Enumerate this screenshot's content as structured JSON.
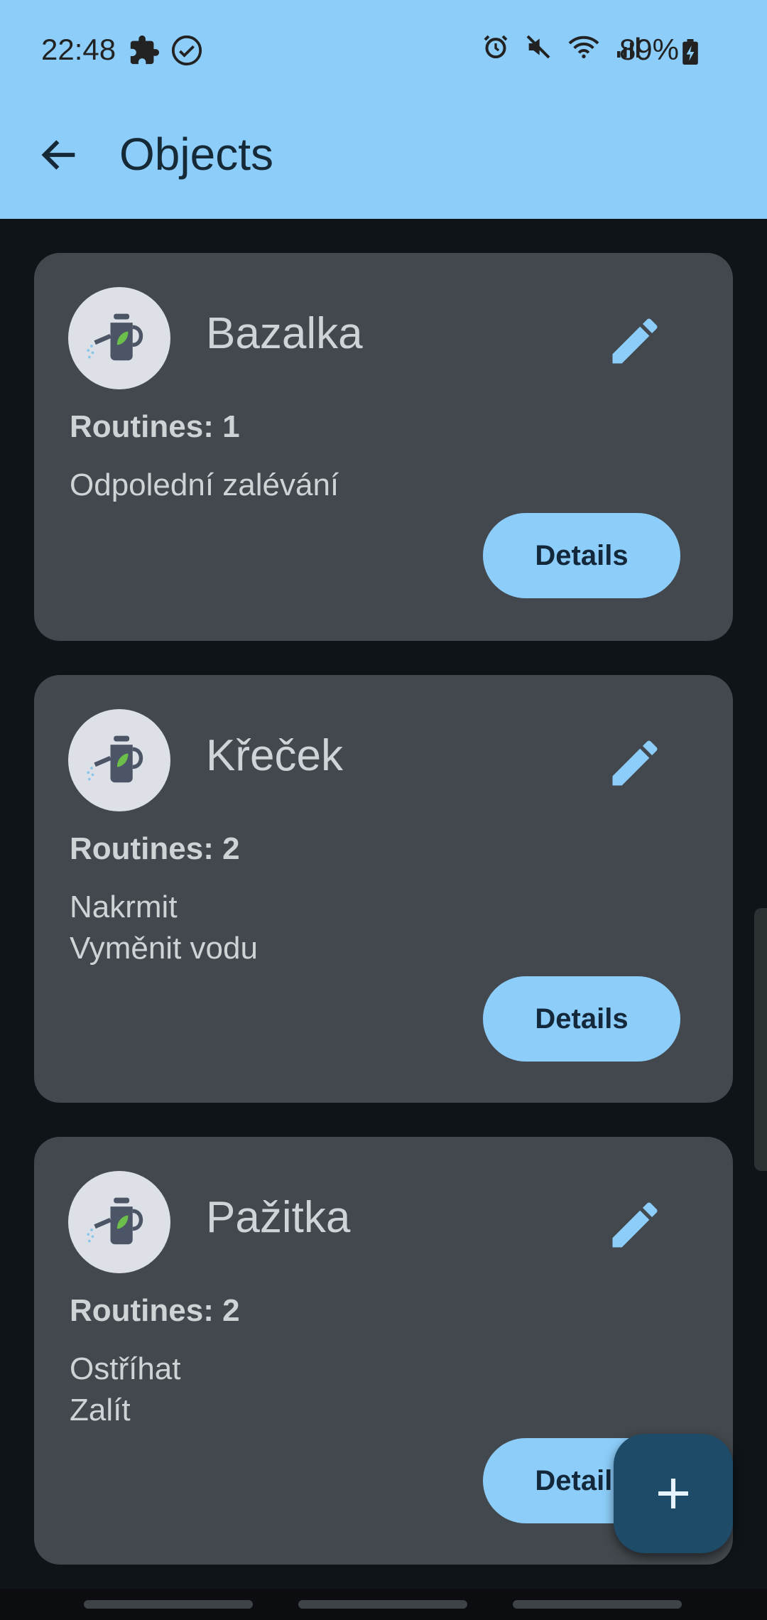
{
  "status": {
    "time": "22:48",
    "battery": "89%"
  },
  "appbar": {
    "title": "Objects"
  },
  "objects": [
    {
      "name": "Bazalka",
      "routines_label": "Routines: 1",
      "routines": [
        "Odpolední zalévání"
      ],
      "details_label": "Details"
    },
    {
      "name": "Křeček",
      "routines_label": "Routines: 2",
      "routines": [
        "Nakrmit",
        "Vyměnit vodu"
      ],
      "details_label": "Details"
    },
    {
      "name": "Pažitka",
      "routines_label": "Routines: 2",
      "routines": [
        "Ostříhat",
        "Zalít"
      ],
      "details_label": "Details"
    }
  ],
  "icons": {
    "back": "arrow-back-icon",
    "edit": "pencil-icon",
    "avatar": "watering-can-icon",
    "fab": "plus-icon"
  },
  "colors": {
    "accent": "#8dcdf9",
    "card": "#42484d",
    "background": "#0f1419",
    "fab": "#1e4b68"
  }
}
